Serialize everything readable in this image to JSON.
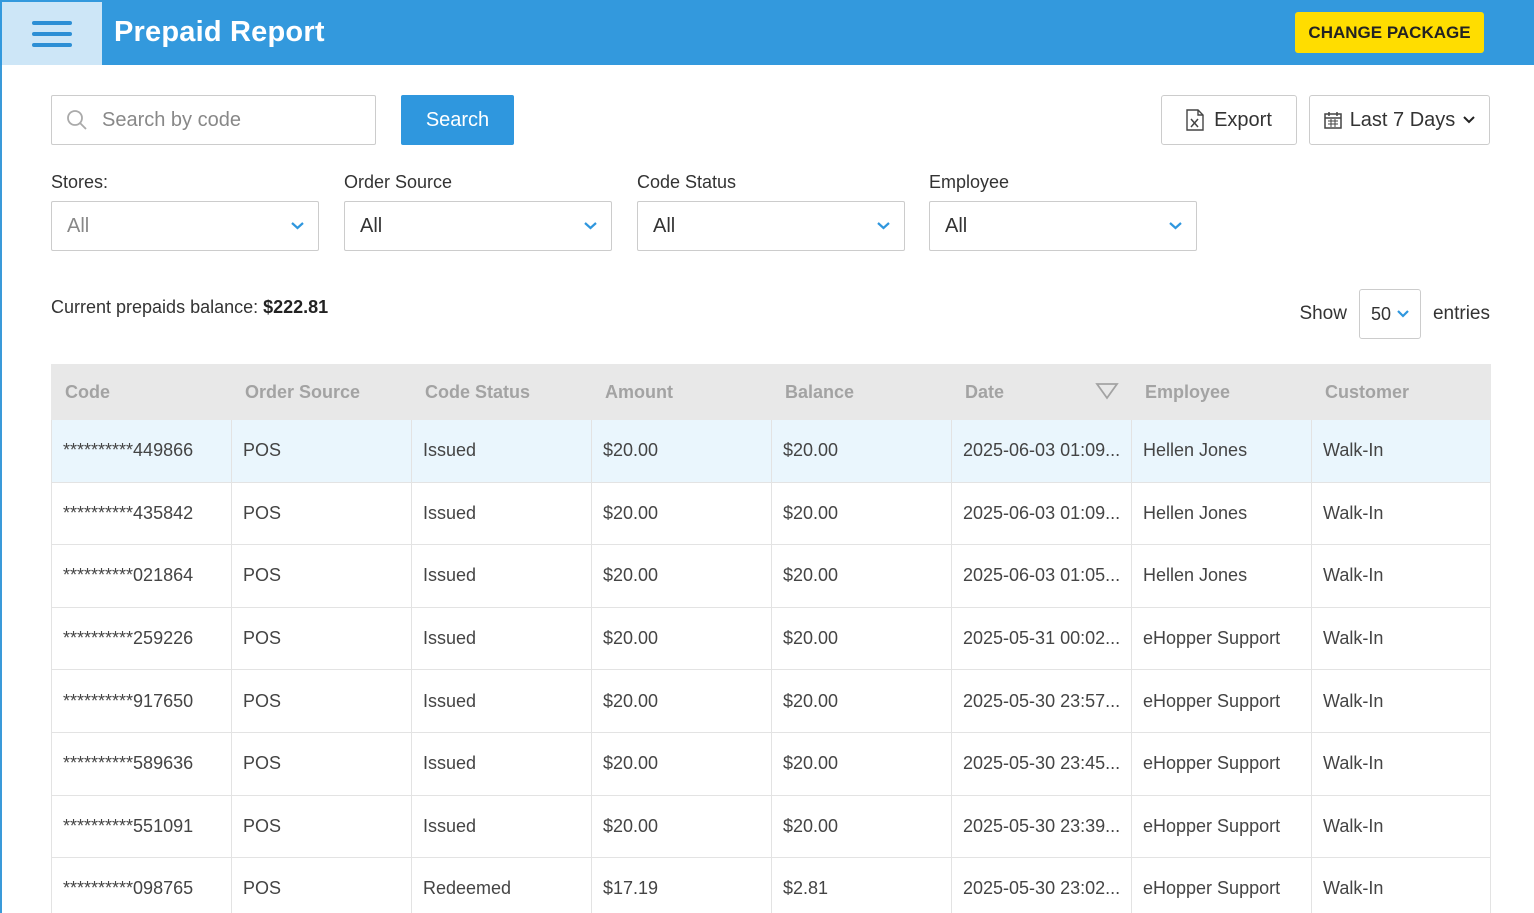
{
  "header": {
    "title": "Prepaid Report",
    "change_package_label": "CHANGE PACKAGE"
  },
  "toolbar": {
    "search_placeholder": "Search by code",
    "search_label": "Search",
    "export_label": "Export",
    "date_range_label": "Last 7 Days"
  },
  "filters": [
    {
      "label": "Stores:",
      "value": "All"
    },
    {
      "label": "Order Source",
      "value": "All"
    },
    {
      "label": "Code Status",
      "value": "All"
    },
    {
      "label": "Employee",
      "value": "All"
    }
  ],
  "balance": {
    "label": "Current prepaids balance: ",
    "value": "$222.81"
  },
  "pagination": {
    "show_label": "Show",
    "entries_value": "50",
    "entries_label": "entries"
  },
  "table": {
    "columns": [
      "Code",
      "Order Source",
      "Code Status",
      "Amount",
      "Balance",
      "Date",
      "Employee",
      "Customer"
    ],
    "rows": [
      [
        "**********449866",
        "POS",
        "Issued",
        "$20.00",
        "$20.00",
        "2025-06-03 01:09...",
        "Hellen Jones",
        "Walk-In"
      ],
      [
        "**********435842",
        "POS",
        "Issued",
        "$20.00",
        "$20.00",
        "2025-06-03 01:09...",
        "Hellen Jones",
        "Walk-In"
      ],
      [
        "**********021864",
        "POS",
        "Issued",
        "$20.00",
        "$20.00",
        "2025-06-03 01:05...",
        "Hellen Jones",
        "Walk-In"
      ],
      [
        "**********259226",
        "POS",
        "Issued",
        "$20.00",
        "$20.00",
        "2025-05-31 00:02...",
        "eHopper Support",
        "Walk-In"
      ],
      [
        "**********917650",
        "POS",
        "Issued",
        "$20.00",
        "$20.00",
        "2025-05-30 23:57...",
        "eHopper Support",
        "Walk-In"
      ],
      [
        "**********589636",
        "POS",
        "Issued",
        "$20.00",
        "$20.00",
        "2025-05-30 23:45...",
        "eHopper Support",
        "Walk-In"
      ],
      [
        "**********551091",
        "POS",
        "Issued",
        "$20.00",
        "$20.00",
        "2025-05-30 23:39...",
        "eHopper Support",
        "Walk-In"
      ],
      [
        "**********098765",
        "POS",
        "Redeemed",
        "$17.19",
        "$2.81",
        "2025-05-30 23:02...",
        "eHopper Support",
        "Walk-In"
      ]
    ]
  },
  "colors": {
    "topbar": "#3399dd",
    "accent_button": "#2f97de",
    "change_package": "#ffdd00",
    "row_highlight": "#eaf6fd"
  }
}
